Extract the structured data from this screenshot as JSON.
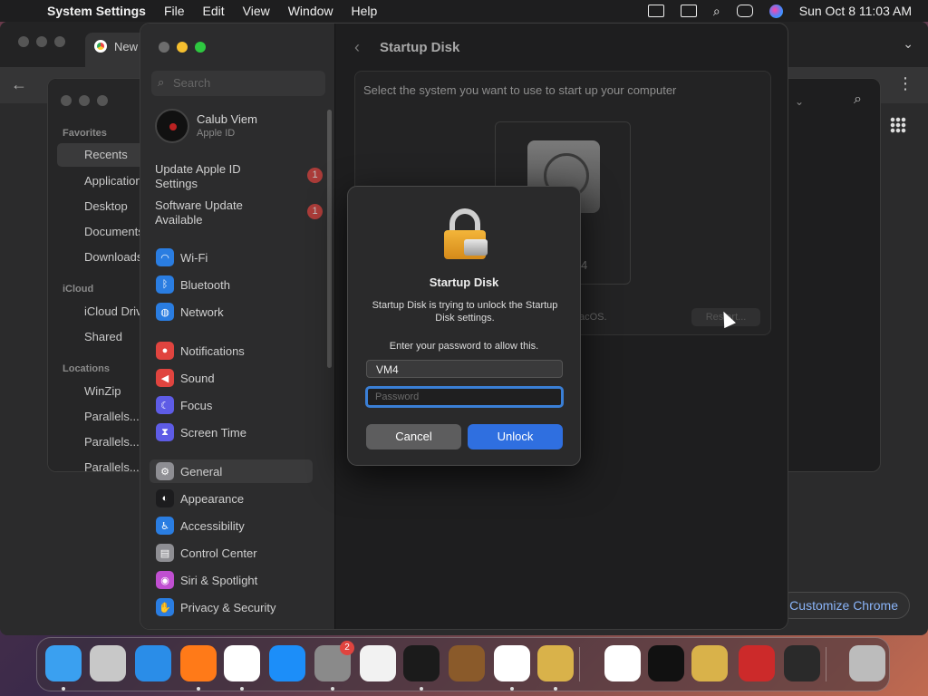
{
  "menubar": {
    "app_name": "System Settings",
    "menus": [
      "File",
      "Edit",
      "View",
      "Window",
      "Help"
    ],
    "clock": "Sun Oct 8  11:03 AM"
  },
  "chrome": {
    "tab_title": "New",
    "customize_label": "Customize Chrome"
  },
  "finder": {
    "sections": [
      {
        "title": "Favorites",
        "items": [
          "Recents",
          "Applications",
          "Desktop",
          "Documents",
          "Downloads"
        ]
      },
      {
        "title": "iCloud",
        "items": [
          "iCloud Drive",
          "Shared"
        ]
      },
      {
        "title": "Locations",
        "items": [
          "WinZip",
          "Parallels...",
          "Parallels...",
          "Parallels..."
        ]
      }
    ],
    "selected_item": "Recents"
  },
  "settings": {
    "search_placeholder": "Search",
    "profile": {
      "name": "Calub Viem",
      "subtitle": "Apple ID"
    },
    "notices": [
      {
        "label": "Update Apple ID Settings",
        "badge": "1"
      },
      {
        "label": "Software Update Available",
        "badge": "1"
      }
    ],
    "nav_groups": [
      [
        {
          "label": "Wi-Fi",
          "icon": "wifi-icon",
          "color": "#2a7de1"
        },
        {
          "label": "Bluetooth",
          "icon": "bluetooth-icon",
          "color": "#2a7de1"
        },
        {
          "label": "Network",
          "icon": "globe-icon",
          "color": "#2a7de1"
        }
      ],
      [
        {
          "label": "Notifications",
          "icon": "bell-icon",
          "color": "#e0443f"
        },
        {
          "label": "Sound",
          "icon": "speaker-icon",
          "color": "#e0443f"
        },
        {
          "label": "Focus",
          "icon": "moon-icon",
          "color": "#5e5ce6"
        },
        {
          "label": "Screen Time",
          "icon": "hourglass-icon",
          "color": "#5e5ce6"
        }
      ],
      [
        {
          "label": "General",
          "icon": "gear-icon",
          "color": "#8e8e93"
        },
        {
          "label": "Appearance",
          "icon": "appearance-icon",
          "color": "#1c1c1e"
        },
        {
          "label": "Accessibility",
          "icon": "accessibility-icon",
          "color": "#2a7de1"
        },
        {
          "label": "Control Center",
          "icon": "control-center-icon",
          "color": "#8e8e93"
        },
        {
          "label": "Siri & Spotlight",
          "icon": "siri-icon",
          "color": "#c04fd1"
        },
        {
          "label": "Privacy & Security",
          "icon": "hand-icon",
          "color": "#2a7de1"
        }
      ]
    ],
    "selected_nav": "General",
    "page_title": "Startup Disk",
    "instruction": "Select the system you want to use to start up your computer",
    "disk_label_fragment": "4",
    "macos_fragment": "acOS.",
    "restart_label": "Restart..."
  },
  "dialog": {
    "title": "Startup Disk",
    "message": "Startup Disk is trying to unlock the Startup Disk settings.",
    "prompt": "Enter your password to allow this.",
    "username_value": "VM4",
    "password_placeholder": "Password",
    "cancel_label": "Cancel",
    "unlock_label": "Unlock"
  },
  "dock": {
    "apps": [
      {
        "name": "Finder",
        "icon": "finder-icon",
        "color": "#3aa0f0"
      },
      {
        "name": "Launchpad",
        "icon": "launchpad-icon",
        "color": "#c8c8c8"
      },
      {
        "name": "Safari",
        "icon": "safari-icon",
        "color": "#2a8de8"
      },
      {
        "name": "Firefox",
        "icon": "firefox-icon",
        "color": "#ff7a18"
      },
      {
        "name": "Chrome",
        "icon": "chrome-icon",
        "color": "#ffffff"
      },
      {
        "name": "App Store",
        "icon": "app-store-icon",
        "color": "#1c8ef9"
      },
      {
        "name": "System Settings",
        "icon": "settings-icon",
        "color": "#8a8a8a",
        "badge": "2"
      },
      {
        "name": "TextEdit",
        "icon": "textedit-icon",
        "color": "#f2f2f2"
      },
      {
        "name": "Terminal",
        "icon": "terminal-icon",
        "color": "#1b1b1b"
      },
      {
        "name": "GarageBand",
        "icon": "garageband-icon",
        "color": "#8a5a2a"
      },
      {
        "name": "VS Code",
        "icon": "vscode-icon",
        "color": "#ffffff"
      },
      {
        "name": "Archive Utility",
        "icon": "archive-icon",
        "color": "#d9b24a"
      },
      {
        "name": "Freeform",
        "icon": "freeform-icon",
        "color": "#ffffff"
      },
      {
        "name": "Apple TV",
        "icon": "appletv-icon",
        "color": "#111111"
      },
      {
        "name": "WinZip",
        "icon": "winzip-icon",
        "color": "#d9b24a"
      },
      {
        "name": "Parallels",
        "icon": "parallels-icon",
        "color": "#cc2a2a"
      },
      {
        "name": "Downloads",
        "icon": "downloads-stack-icon",
        "color": "#2a2a2a"
      },
      {
        "name": "Trash",
        "icon": "trash-icon",
        "color": "#bcbcbc"
      }
    ]
  }
}
